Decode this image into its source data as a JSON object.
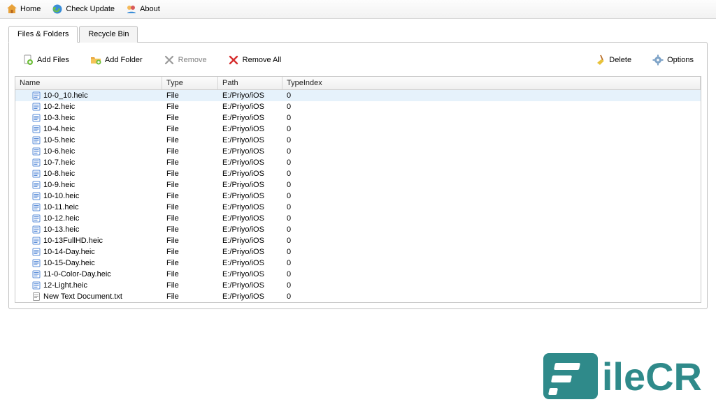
{
  "topbar": {
    "home": "Home",
    "check_update": "Check Update",
    "about": "About"
  },
  "tabs": {
    "files_folders": "Files & Folders",
    "recycle_bin": "Recycle Bin"
  },
  "toolbar": {
    "add_files": "Add Files",
    "add_folder": "Add Folder",
    "remove": "Remove",
    "remove_all": "Remove All",
    "delete": "Delete",
    "options": "Options"
  },
  "grid": {
    "headers": {
      "name": "Name",
      "type": "Type",
      "path": "Path",
      "typeindex": "TypeIndex"
    },
    "rows": [
      {
        "name": "10-0_10.heic",
        "type": "File",
        "path": "E:/Priyo/iOS",
        "typeindex": "0",
        "icon": "heic"
      },
      {
        "name": "10-2.heic",
        "type": "File",
        "path": "E:/Priyo/iOS",
        "typeindex": "0",
        "icon": "heic"
      },
      {
        "name": "10-3.heic",
        "type": "File",
        "path": "E:/Priyo/iOS",
        "typeindex": "0",
        "icon": "heic"
      },
      {
        "name": "10-4.heic",
        "type": "File",
        "path": "E:/Priyo/iOS",
        "typeindex": "0",
        "icon": "heic"
      },
      {
        "name": "10-5.heic",
        "type": "File",
        "path": "E:/Priyo/iOS",
        "typeindex": "0",
        "icon": "heic"
      },
      {
        "name": "10-6.heic",
        "type": "File",
        "path": "E:/Priyo/iOS",
        "typeindex": "0",
        "icon": "heic"
      },
      {
        "name": "10-7.heic",
        "type": "File",
        "path": "E:/Priyo/iOS",
        "typeindex": "0",
        "icon": "heic"
      },
      {
        "name": "10-8.heic",
        "type": "File",
        "path": "E:/Priyo/iOS",
        "typeindex": "0",
        "icon": "heic"
      },
      {
        "name": "10-9.heic",
        "type": "File",
        "path": "E:/Priyo/iOS",
        "typeindex": "0",
        "icon": "heic"
      },
      {
        "name": "10-10.heic",
        "type": "File",
        "path": "E:/Priyo/iOS",
        "typeindex": "0",
        "icon": "heic"
      },
      {
        "name": "10-11.heic",
        "type": "File",
        "path": "E:/Priyo/iOS",
        "typeindex": "0",
        "icon": "heic"
      },
      {
        "name": "10-12.heic",
        "type": "File",
        "path": "E:/Priyo/iOS",
        "typeindex": "0",
        "icon": "heic"
      },
      {
        "name": "10-13.heic",
        "type": "File",
        "path": "E:/Priyo/iOS",
        "typeindex": "0",
        "icon": "heic"
      },
      {
        "name": "10-13FullHD.heic",
        "type": "File",
        "path": "E:/Priyo/iOS",
        "typeindex": "0",
        "icon": "heic"
      },
      {
        "name": "10-14-Day.heic",
        "type": "File",
        "path": "E:/Priyo/iOS",
        "typeindex": "0",
        "icon": "heic"
      },
      {
        "name": "10-15-Day.heic",
        "type": "File",
        "path": "E:/Priyo/iOS",
        "typeindex": "0",
        "icon": "heic"
      },
      {
        "name": "11-0-Color-Day.heic",
        "type": "File",
        "path": "E:/Priyo/iOS",
        "typeindex": "0",
        "icon": "heic"
      },
      {
        "name": "12-Light.heic",
        "type": "File",
        "path": "E:/Priyo/iOS",
        "typeindex": "0",
        "icon": "heic"
      },
      {
        "name": "New Text Document.txt",
        "type": "File",
        "path": "E:/Priyo/iOS",
        "typeindex": "0",
        "icon": "txt"
      }
    ]
  },
  "watermark": "ileCR"
}
